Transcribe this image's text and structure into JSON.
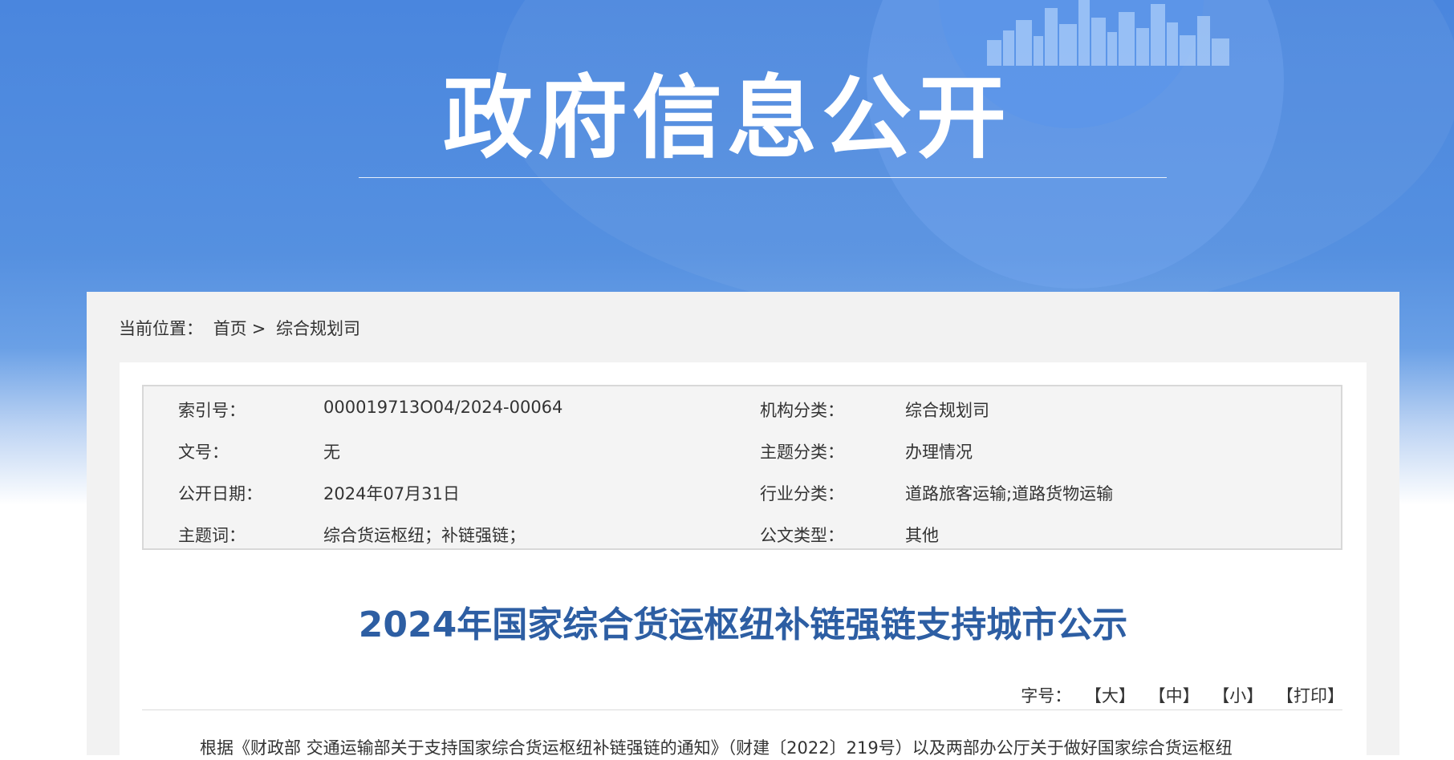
{
  "banner": {
    "title": "政府信息公开"
  },
  "breadcrumb": {
    "label": "当前位置：",
    "home": "首页",
    "sep": ">",
    "current": "综合规划司"
  },
  "meta": {
    "rows": [
      {
        "k1": "索引号：",
        "v1": "000019713O04/2024-00064",
        "k2": "机构分类：",
        "v2": "综合规划司"
      },
      {
        "k1": "文号：",
        "v1": "无",
        "k2": "主题分类：",
        "v2": "办理情况"
      },
      {
        "k1": "公开日期：",
        "v1": "2024年07月31日",
        "k2": "行业分类：",
        "v2": "道路旅客运输;道路货物运输"
      },
      {
        "k1": "主题词：",
        "v1": "综合货运枢纽；补链强链；",
        "k2": "公文类型：",
        "v2": "其他"
      }
    ]
  },
  "document": {
    "title": "2024年国家综合货运枢纽补链强链支持城市公示",
    "font_size_label": "字号：",
    "font_large": "【大】",
    "font_medium": "【中】",
    "font_small": "【小】",
    "print": "【打印】",
    "body_first_line": "根据《财政部 交通运输部关于支持国家综合货运枢纽补链强链的通知》（财建〔2022〕219号）以及两部办公厅关于做好国家综合货运枢纽"
  },
  "colors": {
    "banner": "#4a86de",
    "title_blue": "#2d5ea3"
  }
}
